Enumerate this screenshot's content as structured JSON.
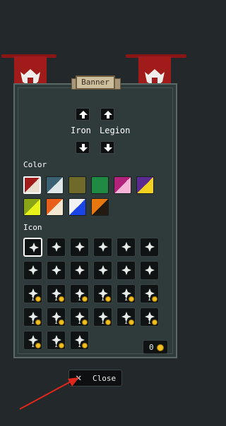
{
  "title": "Banner",
  "banner_name": {
    "first_word": "Iron",
    "second_word": "Legion"
  },
  "color_section_label": "Color",
  "icon_section_label": "Icon",
  "colors": [
    [
      "#a31c1c",
      "#e8e0d0"
    ],
    [
      "#3a6272",
      "#dfe7e8"
    ],
    [
      "#6f6a2a",
      "#6f6a2a"
    ],
    [
      "#1f8a44",
      "#1f8a44"
    ],
    [
      "#b2227a",
      "#f6b4d8"
    ],
    [
      "#5a2a90",
      "#f2d21e"
    ],
    [
      "#8aa418",
      "#e6f21a"
    ],
    [
      "#e8601a",
      "#f5e8d0"
    ],
    [
      "#f2f2f2",
      "#1a44e6"
    ],
    [
      "#e8780e",
      "#231a12"
    ]
  ],
  "icons": [
    {
      "name": "winged-swords-icon",
      "cost": ""
    },
    {
      "name": "crescent-moon-icon",
      "cost": ""
    },
    {
      "name": "crossed-swords-icon",
      "cost": ""
    },
    {
      "name": "splash-icon",
      "cost": ""
    },
    {
      "name": "sun-burst-icon",
      "cost": ""
    },
    {
      "name": "crossed-blades-icon",
      "cost": ""
    },
    {
      "name": "star-icon",
      "cost": ""
    },
    {
      "name": "flame-icon",
      "cost": ""
    },
    {
      "name": "dagger-icon",
      "cost": ""
    },
    {
      "name": "bow-icon",
      "cost": ""
    },
    {
      "name": "mask-icon",
      "cost": ""
    },
    {
      "name": "fist-icon",
      "cost": ""
    },
    {
      "name": "fleur-de-lis-icon",
      "cost": "1"
    },
    {
      "name": "trident-cross-icon",
      "cost": "1"
    },
    {
      "name": "crown-icon",
      "cost": "1"
    },
    {
      "name": "shield-icon",
      "cost": "1"
    },
    {
      "name": "snowflake-icon",
      "cost": "1"
    },
    {
      "name": "ankh-icon",
      "cost": "1"
    },
    {
      "name": "sword-upright-icon",
      "cost": "1"
    },
    {
      "name": "diamond-icon",
      "cost": "1"
    },
    {
      "name": "star-medallion-icon",
      "cost": "1"
    },
    {
      "name": "cross-hilt-icon",
      "cost": "1"
    },
    {
      "name": "raven-icon",
      "cost": "1"
    },
    {
      "name": "staff-icon",
      "cost": "1"
    },
    {
      "name": "tower-icon",
      "cost": "1"
    },
    {
      "name": "horseshoe-icon",
      "cost": "1"
    },
    {
      "name": "figure-icon",
      "cost": "1"
    }
  ],
  "coins": "0",
  "close_label": "Close",
  "close_symbol": "✕"
}
